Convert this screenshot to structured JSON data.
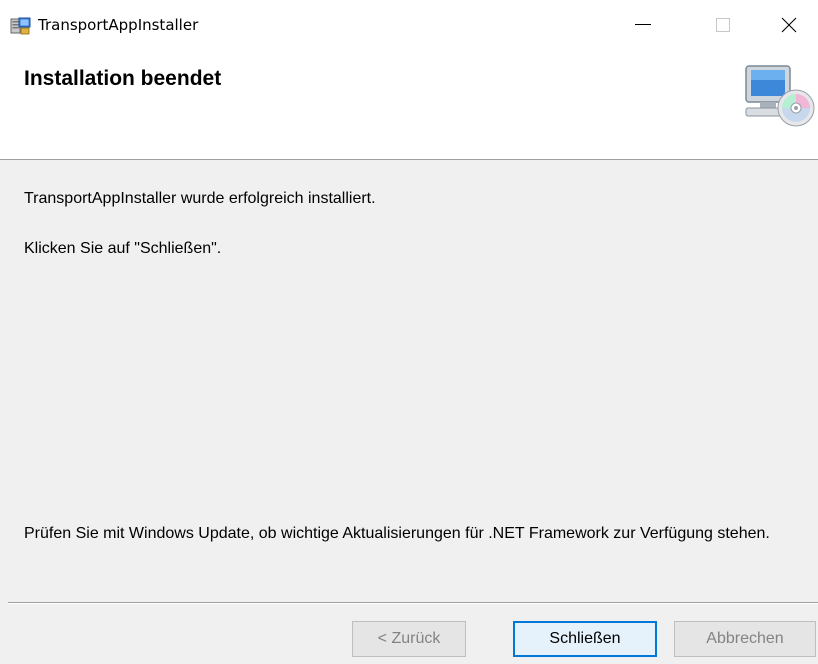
{
  "window": {
    "title": "TransportAppInstaller",
    "icon": "installer-app-icon",
    "controls": {
      "minimize_icon": "minimize-icon",
      "maximize_icon": "maximize-icon",
      "close_icon": "close-icon"
    }
  },
  "header": {
    "title": "Installation beendet",
    "icon": "computer-cd-icon"
  },
  "content": {
    "message_success": "TransportAppInstaller wurde erfolgreich installiert.",
    "message_instruction": "Klicken Sie auf \"Schließen\".",
    "message_update": "Prüfen Sie mit Windows Update, ob wichtige Aktualisierungen für .NET Framework zur Verfügung stehen."
  },
  "buttons": {
    "back": {
      "label": "< Zurück",
      "enabled": false
    },
    "close": {
      "label": "Schließen",
      "enabled": true,
      "default": true
    },
    "cancel": {
      "label": "Abbrechen",
      "enabled": false
    }
  },
  "colors": {
    "accent": "#0078d7",
    "dialog_background": "#f0f0f0",
    "header_background": "#ffffff",
    "disabled_text": "#838383"
  }
}
